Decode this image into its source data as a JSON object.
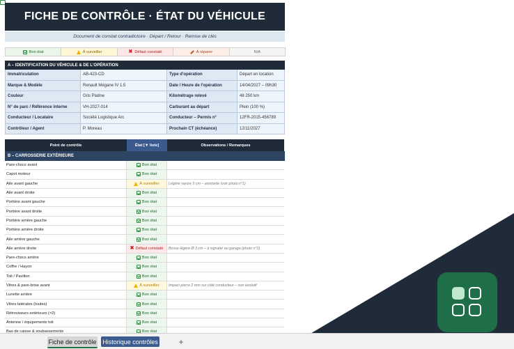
{
  "header": {
    "title": "FICHE DE CONTRÔLE  ·  ÉTAT DU VÉHICULE",
    "subtitle": "Document de constat contradictoire · Départ / Retour · Remise de clés"
  },
  "legend": [
    {
      "label": "Bon état",
      "icon": "check-icon"
    },
    {
      "label": "À surveiller",
      "icon": "warning-icon"
    },
    {
      "label": "Défaut constaté",
      "icon": "cross-icon"
    },
    {
      "label": "À réparer",
      "icon": "wrench-icon"
    },
    {
      "label": "N/A",
      "icon": ""
    }
  ],
  "section_a": {
    "title": "A  –  IDENTIFICATION DU VÉHICULE & DE L'OPÉRATION",
    "rows": [
      {
        "l1": "Immatriculation",
        "v1": "AB-423-CD",
        "l2": "Type d'opération",
        "v2": "Départ en location"
      },
      {
        "l1": "Marque & Modèle",
        "v1": "Renault Mégane IV 1.5",
        "l2": "Date / Heure de l'opération",
        "v2": "14/04/2027 – 09h30"
      },
      {
        "l1": "Couleur",
        "v1": "Gris Platine",
        "l2": "Kilométrage relevé",
        "v2": "48 250 km"
      },
      {
        "l1": "N° de parc / Référence interne",
        "v1": "VH-2027-014",
        "l2": "Carburant au départ",
        "v2": "Plein (100 %)"
      },
      {
        "l1": "Conducteur / Locataire",
        "v1": "Société Logistique Arc",
        "l2": "Conducteur – Permis n°",
        "v2": "12FR-2015-456789"
      },
      {
        "l1": "Contrôleur / Agent",
        "v1": "P. Moreau",
        "l2": "Prochain CT (échéance)",
        "v2": "12/11/2027"
      }
    ]
  },
  "checklist": {
    "headers": {
      "point": "Point de contrôle",
      "etat": "État [▼ liste]",
      "obs": "Observations / Remarques"
    },
    "section_b_title": "B  –  CARROSSERIE EXTÉRIEURE",
    "rows": [
      {
        "point": "Pare-chocs avant",
        "etat": "Bon état",
        "status": "ok",
        "obs": ""
      },
      {
        "point": "Capot moteur",
        "etat": "Bon état",
        "status": "ok",
        "obs": ""
      },
      {
        "point": "Aile avant gauche",
        "etat": "À surveiller",
        "status": "watch",
        "obs": "Légère rayure 5 cm – existante (voir photo n°1)"
      },
      {
        "point": "Aile avant droite",
        "etat": "Bon état",
        "status": "ok",
        "obs": ""
      },
      {
        "point": "Portière avant gauche",
        "etat": "Bon état",
        "status": "ok",
        "obs": ""
      },
      {
        "point": "Portière avant droite",
        "etat": "Bon état",
        "status": "ok",
        "obs": ""
      },
      {
        "point": "Portière arrière gauche",
        "etat": "Bon état",
        "status": "ok",
        "obs": ""
      },
      {
        "point": "Portière arrière droite",
        "etat": "Bon état",
        "status": "ok",
        "obs": ""
      },
      {
        "point": "Aile arrière gauche",
        "etat": "Bon état",
        "status": "ok",
        "obs": ""
      },
      {
        "point": "Aile arrière droite",
        "etat": "Défaut constaté",
        "status": "def",
        "obs": "Bosse légère Ø 3 cm – à signaler au garage (photo n°2)"
      },
      {
        "point": "Pare-chocs arrière",
        "etat": "Bon état",
        "status": "ok",
        "obs": ""
      },
      {
        "point": "Coffre / Hayon",
        "etat": "Bon état",
        "status": "ok",
        "obs": ""
      },
      {
        "point": "Toit / Pavillon",
        "etat": "Bon état",
        "status": "ok",
        "obs": ""
      },
      {
        "point": "Vitres & pare-brise avant",
        "etat": "À surveiller",
        "status": "watch",
        "obs": "Impact pierre 2 mm sur côté conducteur – non évolutif"
      },
      {
        "point": "Lunette arrière",
        "etat": "Bon état",
        "status": "ok",
        "obs": ""
      },
      {
        "point": "Vitres latérales (toutes)",
        "etat": "Bon état",
        "status": "ok",
        "obs": ""
      },
      {
        "point": "Rétroviseurs extérieurs (×2)",
        "etat": "Bon état",
        "status": "ok",
        "obs": ""
      },
      {
        "point": "Antenne / équipements toit",
        "etat": "Bon état",
        "status": "ok",
        "obs": ""
      },
      {
        "point": "Bas de caisse & soubassements",
        "etat": "Bon état",
        "status": "ok",
        "obs": ""
      }
    ]
  },
  "tabs": [
    {
      "label": "Fiche de contrôle",
      "active": true
    },
    {
      "label": "Historique contrôles",
      "active": false
    }
  ],
  "tab_add": "+",
  "colors": {
    "header": "#1f2b38",
    "accent": "#3b5b8e",
    "ok": "#2e8b3e",
    "watch": "#f0b400",
    "defect": "#c62828",
    "brand": "#1e6e48"
  }
}
